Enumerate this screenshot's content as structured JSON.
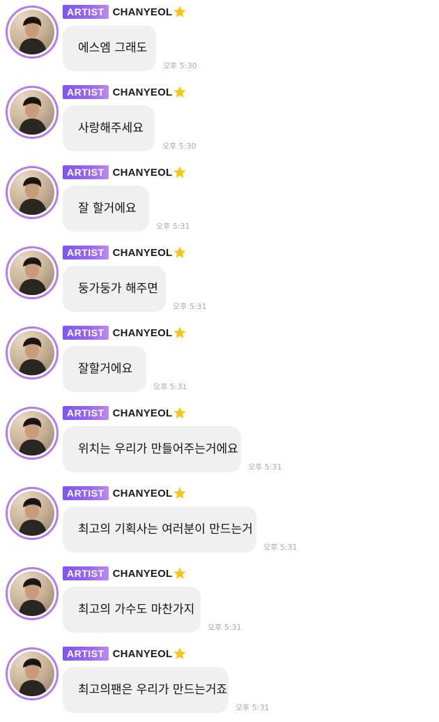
{
  "colors": {
    "badge_gradient_start": "#7b56f0",
    "badge_gradient_end": "#bb8af0",
    "avatar_ring": "#b57be8",
    "bubble_bg": "#f0f0f0",
    "timestamp": "#a8a8a8",
    "star": "#f5c518"
  },
  "messages": [
    {
      "badge": "ARTIST",
      "author": "CHANYEOL",
      "author_icon": "star-icon",
      "text": "에스엠 그래도",
      "time": "오후 5:30"
    },
    {
      "badge": "ARTIST",
      "author": "CHANYEOL",
      "author_icon": "star-icon",
      "text": "사랑해주세요",
      "time": "오후 5:30"
    },
    {
      "badge": "ARTIST",
      "author": "CHANYEOL",
      "author_icon": "star-icon",
      "text": "잘 할거에요",
      "time": "오후 5:31"
    },
    {
      "badge": "ARTIST",
      "author": "CHANYEOL",
      "author_icon": "star-icon",
      "text": "둥가둥가 해주면",
      "time": "오후 5:31"
    },
    {
      "badge": "ARTIST",
      "author": "CHANYEOL",
      "author_icon": "star-icon",
      "text": "잘할거에요",
      "time": "오후 5:31"
    },
    {
      "badge": "ARTIST",
      "author": "CHANYEOL",
      "author_icon": "star-icon",
      "text": "위치는 우리가 만들어주는거에요",
      "time": "오후 5:31"
    },
    {
      "badge": "ARTIST",
      "author": "CHANYEOL",
      "author_icon": "star-icon",
      "text": "최고의 기획사는 여러분이 만드는거",
      "time": "오후 5:31"
    },
    {
      "badge": "ARTIST",
      "author": "CHANYEOL",
      "author_icon": "star-icon",
      "text": "최고의 가수도 마찬가지",
      "time": "오후 5:31"
    },
    {
      "badge": "ARTIST",
      "author": "CHANYEOL",
      "author_icon": "star-icon",
      "text": "최고의팬은 우리가 만드는거죠",
      "time": "오후 5:31"
    }
  ]
}
